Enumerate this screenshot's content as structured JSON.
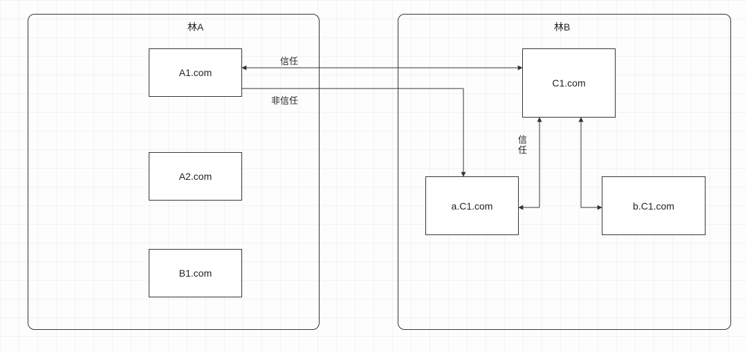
{
  "forests": {
    "A": {
      "title": "林A"
    },
    "B": {
      "title": "林B"
    }
  },
  "nodes": {
    "a1": "A1.com",
    "a2": "A2.com",
    "b1": "B1.com",
    "c1": "C1.com",
    "ac1": "a.C1.com",
    "bc1": "b.C1.com"
  },
  "edges": {
    "trust_a1_c1": "信任",
    "nontrust_a1_ac1": "非信任",
    "trust_c1_ac1": "信任"
  },
  "chart_data": {
    "type": "diagram",
    "title": "",
    "forests": [
      {
        "id": "A",
        "label": "林A",
        "nodes": [
          "A1.com",
          "A2.com",
          "B1.com"
        ]
      },
      {
        "id": "B",
        "label": "林B",
        "nodes": [
          "C1.com",
          "a.C1.com",
          "b.C1.com"
        ]
      }
    ],
    "edges": [
      {
        "from": "A1.com",
        "to": "C1.com",
        "label": "信任",
        "bidirectional": true
      },
      {
        "from": "A1.com",
        "to": "a.C1.com",
        "label": "非信任",
        "bidirectional": false
      },
      {
        "from": "C1.com",
        "to": "a.C1.com",
        "label": "信任",
        "bidirectional": true
      },
      {
        "from": "C1.com",
        "to": "b.C1.com",
        "label": "",
        "bidirectional": true
      }
    ]
  }
}
